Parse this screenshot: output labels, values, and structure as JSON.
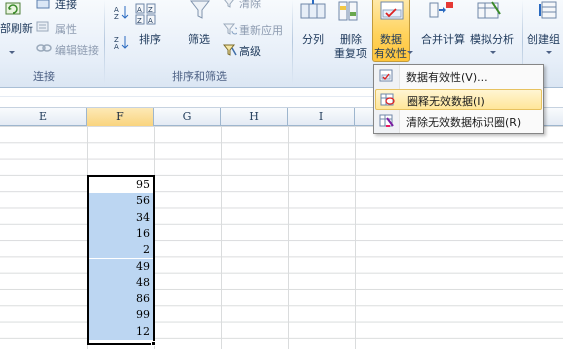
{
  "ribbon": {
    "connections_group": {
      "label": "连接",
      "refresh_all": "部刷新",
      "connections": "连接",
      "properties": "属性",
      "edit_links": "编辑链接"
    },
    "sort_filter_group": {
      "label": "排序和筛选",
      "sort": "排序",
      "filter": "筛选",
      "clear": "清除",
      "reapply": "重新应用",
      "advanced": "高级"
    },
    "data_tools_group": {
      "text_to_columns": "分列",
      "remove_duplicates_line1": "删除",
      "remove_duplicates_line2": "重复项",
      "data_validation_line1": "数据",
      "data_validation_line2": "有效性",
      "consolidate": "合并计算",
      "what_if": "模拟分析"
    },
    "outline_group": {
      "group": "创建组"
    }
  },
  "columns": [
    "E",
    "F",
    "G",
    "H",
    "I"
  ],
  "selected_column": "F",
  "cells": [
    {
      "value": "95",
      "highlighted": false
    },
    {
      "value": "56",
      "highlighted": true
    },
    {
      "value": "34",
      "highlighted": true
    },
    {
      "value": "16",
      "highlighted": true
    },
    {
      "value": "2",
      "highlighted": true
    },
    {
      "value": "49",
      "highlighted": true
    },
    {
      "value": "48",
      "highlighted": true
    },
    {
      "value": "86",
      "highlighted": true
    },
    {
      "value": "99",
      "highlighted": true
    },
    {
      "value": "12",
      "highlighted": true
    }
  ],
  "menu": {
    "items": [
      {
        "label": "数据有效性(V)...",
        "icon": "data-validation-icon",
        "hover": false
      },
      {
        "label": "圈释无效数据(I)",
        "icon": "circle-invalid-icon",
        "hover": true
      },
      {
        "label": "清除无效数据标识圈(R)",
        "icon": "clear-circles-icon",
        "hover": false
      }
    ]
  },
  "colors": {
    "selection_fill": "#bcd6f2",
    "menu_hover": "#ffe699",
    "accent_button": "#ffd35e"
  }
}
